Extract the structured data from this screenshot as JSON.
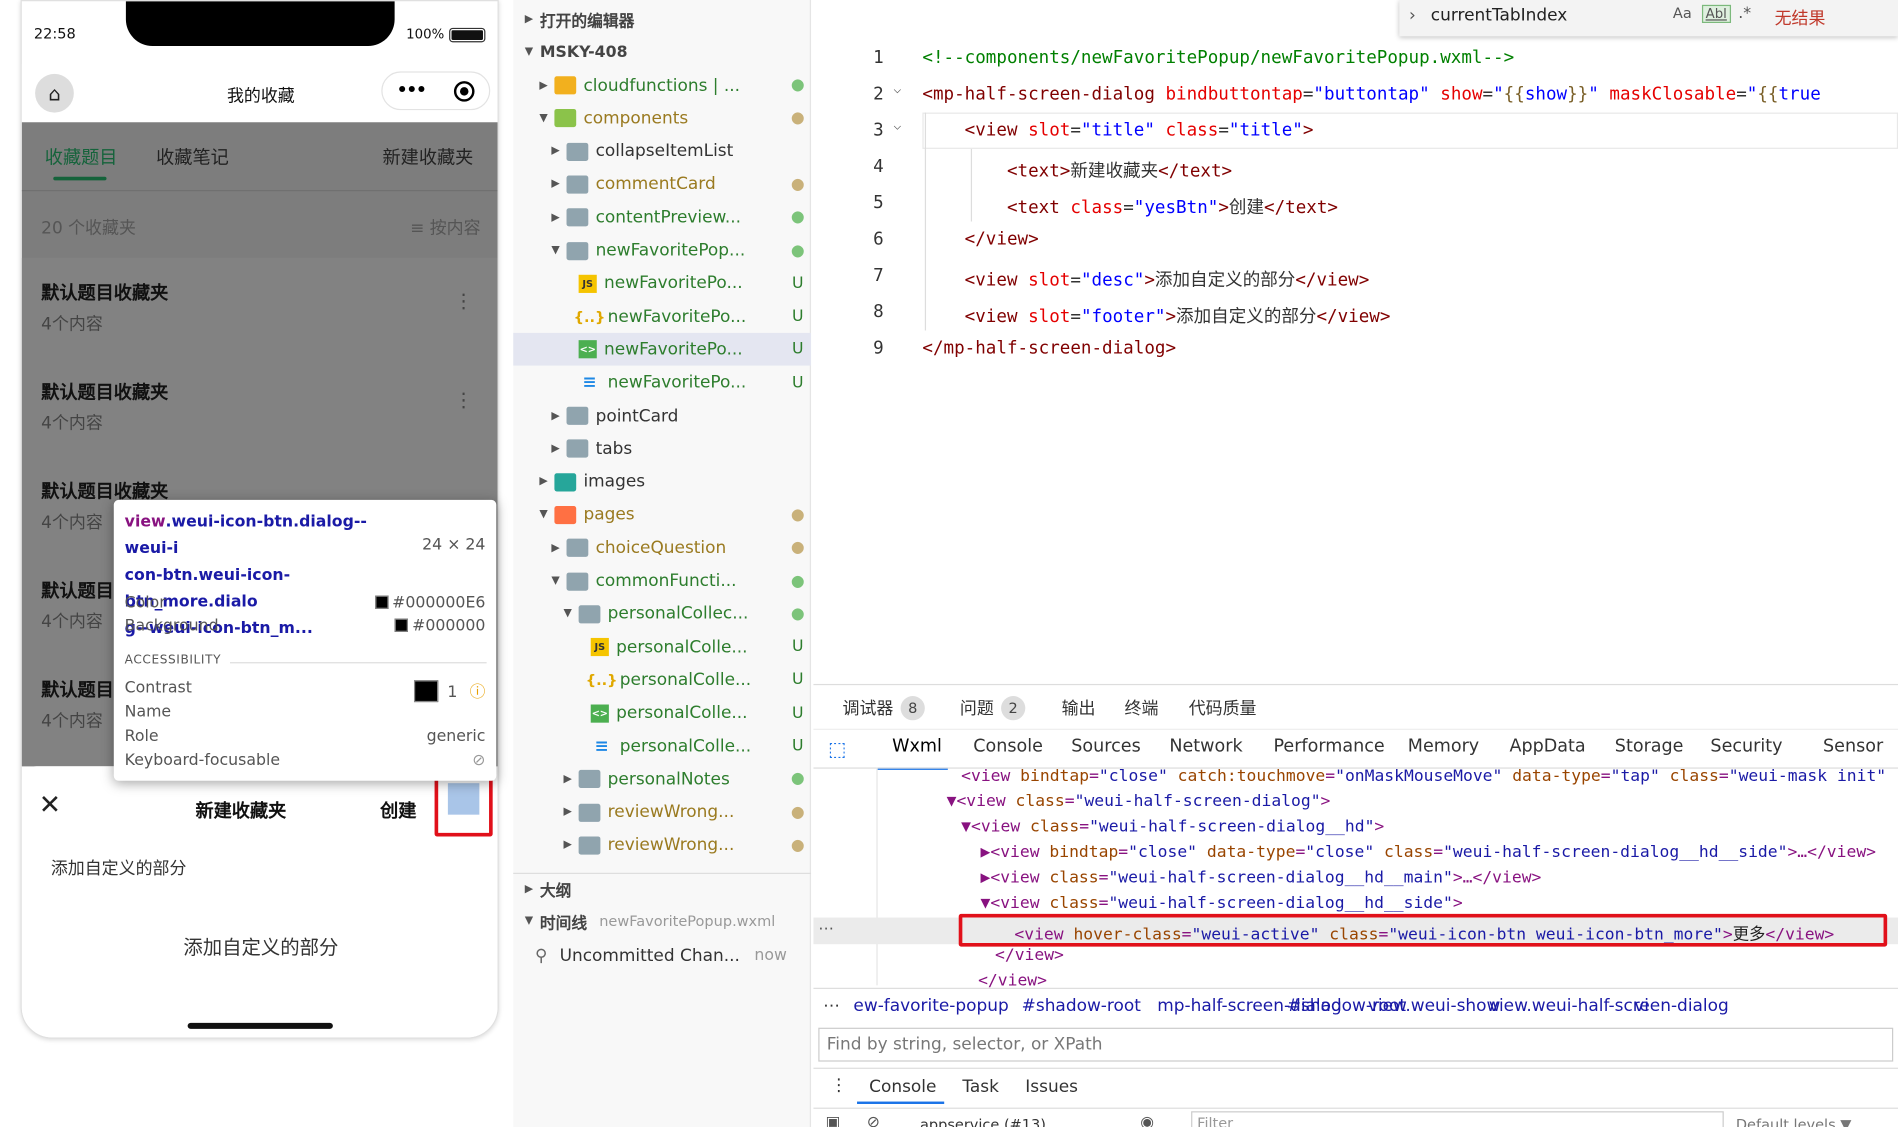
{
  "phone": {
    "time": "22:58",
    "battery": "100%",
    "nav_title": "我的收藏",
    "home_icon": "home-icon",
    "capsule_more": "•••",
    "capsule_target": "target-icon",
    "tabs": [
      "收藏题目",
      "收藏笔记",
      "新建收藏夹"
    ],
    "count": "20 个收藏夹",
    "sort": "≡ 按内容",
    "folders": [
      {
        "name": "默认题目收藏夹",
        "count": "4个内容"
      },
      {
        "name": "默认题目收藏夹",
        "count": "4个内容"
      },
      {
        "name": "默认题目收藏夹",
        "count": "4个内容"
      },
      {
        "name": "默认题目",
        "count": "4个内容"
      },
      {
        "name": "默认题目",
        "count": "4个内容"
      }
    ],
    "sheet": {
      "close": "✕",
      "title": "新建收藏夹",
      "create": "创建",
      "desc": "添加自定义的部分",
      "footer": "添加自定义的部分"
    }
  },
  "tooltip": {
    "selector_a": "view",
    "selector_b": ".weui-icon-btn.dialog--weui-i",
    "selector_c": "con-btn.weui-icon-btn_more.dialo",
    "selector_d": "g--weui-icon-btn_m...",
    "size": "24 × 24",
    "color_label": "Color",
    "color_value": "#000000E6",
    "bg_label": "Background",
    "bg_value": "#000000",
    "section": "ACCESSIBILITY",
    "contrast_label": "Contrast",
    "contrast_value": "1",
    "name_label": "Name",
    "role_label": "Role",
    "role_value": "generic",
    "focus_label": "Keyboard-focusable"
  },
  "explorer": {
    "open_editors": "打开的编辑器",
    "project": "MSKY-408",
    "items": [
      {
        "name": "cloudfunctions | ...",
        "st": "●",
        "stc": "dot-g",
        "ic": "fy",
        "lv": 1,
        "tw": "▶",
        "nc": "g"
      },
      {
        "name": "components",
        "st": "●",
        "stc": "dot-o",
        "ic": "fg",
        "lv": 1,
        "tw": "▼",
        "nc": "o"
      },
      {
        "name": "collapseItemList",
        "st": "",
        "stc": "",
        "ic": "folder",
        "lv": 2,
        "tw": "▶",
        "nc": ""
      },
      {
        "name": "commentCard",
        "st": "●",
        "stc": "dot-o",
        "ic": "folder",
        "lv": 2,
        "tw": "▶",
        "nc": "o"
      },
      {
        "name": "contentPreview...",
        "st": "●",
        "stc": "dot-g",
        "ic": "folder",
        "lv": 2,
        "tw": "▶",
        "nc": "g"
      },
      {
        "name": "newFavoritePop...",
        "st": "●",
        "stc": "dot-g",
        "ic": "folder",
        "lv": 2,
        "tw": "▼",
        "nc": "g"
      },
      {
        "name": "newFavoritePo...",
        "st": "U",
        "stc": "st-u",
        "ic": "js",
        "lv": 3,
        "tw": "",
        "nc": "g",
        "icon_text": "JS"
      },
      {
        "name": "newFavoritePo...",
        "st": "U",
        "stc": "st-u",
        "ic": "json",
        "lv": 3,
        "tw": "",
        "nc": "g",
        "icon_text": "{..}"
      },
      {
        "name": "newFavoritePo...",
        "st": "U",
        "stc": "st-u",
        "ic": "wx",
        "lv": 3,
        "tw": "",
        "nc": "g",
        "icon_text": "<>",
        "sel": true
      },
      {
        "name": "newFavoritePo...",
        "st": "U",
        "stc": "st-u",
        "ic": "css",
        "lv": 3,
        "tw": "",
        "nc": "g",
        "icon_text": "≡"
      },
      {
        "name": "pointCard",
        "st": "",
        "stc": "",
        "ic": "folder",
        "lv": 2,
        "tw": "▶",
        "nc": ""
      },
      {
        "name": "tabs",
        "st": "",
        "stc": "",
        "ic": "folder",
        "lv": 2,
        "tw": "▶",
        "nc": ""
      },
      {
        "name": "images",
        "st": "",
        "stc": "",
        "ic": "fj",
        "lv": 1,
        "tw": "▶",
        "nc": ""
      },
      {
        "name": "pages",
        "st": "●",
        "stc": "dot-o",
        "ic": "fo",
        "lv": 1,
        "tw": "▼",
        "nc": "o"
      },
      {
        "name": "choiceQuestion",
        "st": "●",
        "stc": "dot-o",
        "ic": "folder",
        "lv": 2,
        "tw": "▶",
        "nc": "o"
      },
      {
        "name": "commonFuncti...",
        "st": "●",
        "stc": "dot-g",
        "ic": "folder",
        "lv": 2,
        "tw": "▼",
        "nc": "g"
      },
      {
        "name": "personalCollec...",
        "st": "●",
        "stc": "dot-g",
        "ic": "folder",
        "lv": 3,
        "tw": "▼",
        "nc": "g"
      },
      {
        "name": "personalColle...",
        "st": "U",
        "stc": "st-u",
        "ic": "js",
        "lv": 4,
        "tw": "",
        "nc": "g",
        "icon_text": "JS"
      },
      {
        "name": "personalColle...",
        "st": "U",
        "stc": "st-u",
        "ic": "json",
        "lv": 4,
        "tw": "",
        "nc": "g",
        "icon_text": "{..}"
      },
      {
        "name": "personalColle...",
        "st": "U",
        "stc": "st-u",
        "ic": "wx",
        "lv": 4,
        "tw": "",
        "nc": "g",
        "icon_text": "<>"
      },
      {
        "name": "personalColle...",
        "st": "U",
        "stc": "st-u",
        "ic": "css",
        "lv": 4,
        "tw": "",
        "nc": "g",
        "icon_text": "≡"
      },
      {
        "name": "personalNotes",
        "st": "●",
        "stc": "dot-g",
        "ic": "folder",
        "lv": 3,
        "tw": "▶",
        "nc": "g"
      },
      {
        "name": "reviewWrong...",
        "st": "●",
        "stc": "dot-o",
        "ic": "folder",
        "lv": 3,
        "tw": "▶",
        "nc": "o"
      },
      {
        "name": "reviewWrong...",
        "st": "●",
        "stc": "dot-o",
        "ic": "folder",
        "lv": 3,
        "tw": "▶",
        "nc": "o"
      }
    ],
    "outline": "大纲",
    "timeline": "时间线",
    "timeline_file": "newFavoritePopup.wxml",
    "uncommitted": "Uncommitted Chan...",
    "uncommitted_time": "now"
  },
  "findbar": {
    "query": "currentTabIndex",
    "match_case": "Aa",
    "whole_word": "Abl",
    "regex": ".*",
    "result": "无结果"
  },
  "editor": {
    "lines": [
      "1",
      "2",
      "3",
      "4",
      "5",
      "6",
      "7",
      "8",
      "9"
    ]
  },
  "devtools": {
    "top_tabs": [
      {
        "label": "调试器",
        "badge": "8"
      },
      {
        "label": "问题",
        "badge": "2"
      },
      {
        "label": "输出",
        "badge": ""
      },
      {
        "label": "终端",
        "badge": ""
      },
      {
        "label": "代码质量",
        "badge": ""
      }
    ],
    "panel_tabs": [
      "Wxml",
      "Console",
      "Sources",
      "Network",
      "Performance",
      "Memory",
      "AppData",
      "Storage",
      "Security",
      "Sensor"
    ],
    "breadcrumbs": [
      "ew-favorite-popup",
      "#shadow-root",
      "mp-half-screen-dialog",
      "#shadow-root",
      "view.weui-show",
      "view.weui-half-screen-dialog",
      "vi"
    ],
    "find_placeholder": "Find by string, selector, or XPath",
    "console_tabs": [
      "Console",
      "Task",
      "Issues"
    ],
    "context": "appservice (#13)",
    "filter": "Filter",
    "levels": "Default levels ▼"
  }
}
